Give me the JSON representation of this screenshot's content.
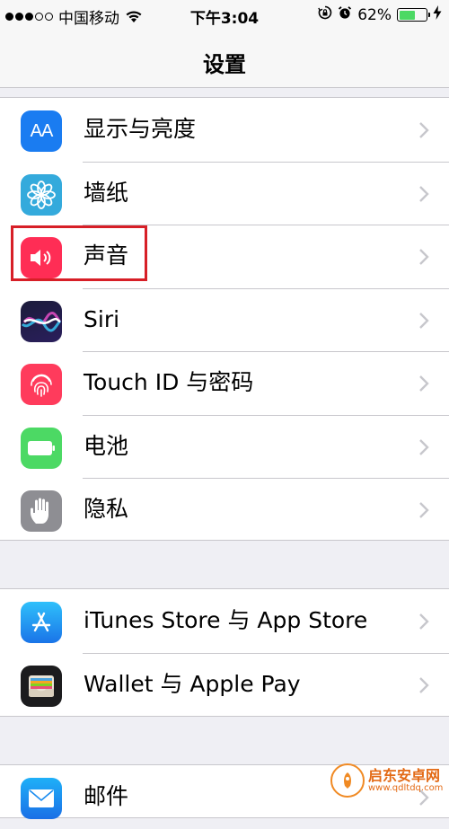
{
  "status_bar": {
    "carrier": "中国移动",
    "time": "下午3:04",
    "battery_text": "62%",
    "battery_level": 0.62,
    "signal_bars_filled": 3,
    "signal_bars_total": 5
  },
  "nav": {
    "title": "设置"
  },
  "groups": [
    {
      "items": [
        {
          "label": "显示与亮度",
          "icon": "display-brightness-icon",
          "color": "#1a7cf1"
        },
        {
          "label": "墙纸",
          "icon": "wallpaper-flower-icon",
          "color": "#34aadc"
        },
        {
          "label": "声音",
          "icon": "speaker-icon",
          "color": "#ff2d55"
        },
        {
          "label": "Siri",
          "icon": "siri-icon",
          "color": "#1b1b3a"
        },
        {
          "label": "Touch ID 与密码",
          "icon": "fingerprint-icon",
          "color": "#ff3b5c"
        },
        {
          "label": "电池",
          "icon": "battery-icon",
          "color": "#4cd964"
        },
        {
          "label": "隐私",
          "icon": "hand-icon",
          "color": "#8e8e93"
        }
      ]
    },
    {
      "items": [
        {
          "label": "iTunes Store 与 App Store",
          "icon": "app-store-icon",
          "color": "#1a8cf5"
        },
        {
          "label": "Wallet 与 Apple Pay",
          "icon": "wallet-icon",
          "color": "#1c1c1e"
        }
      ]
    },
    {
      "items": [
        {
          "label": "邮件",
          "icon": "mail-icon",
          "color": "#1e88f0"
        }
      ]
    }
  ],
  "icon_glyphs": {
    "display_aa": "AA"
  },
  "watermark": {
    "name": "启东安卓网",
    "url": "www.qdltdq.com"
  },
  "highlight_color": "#d71f27"
}
